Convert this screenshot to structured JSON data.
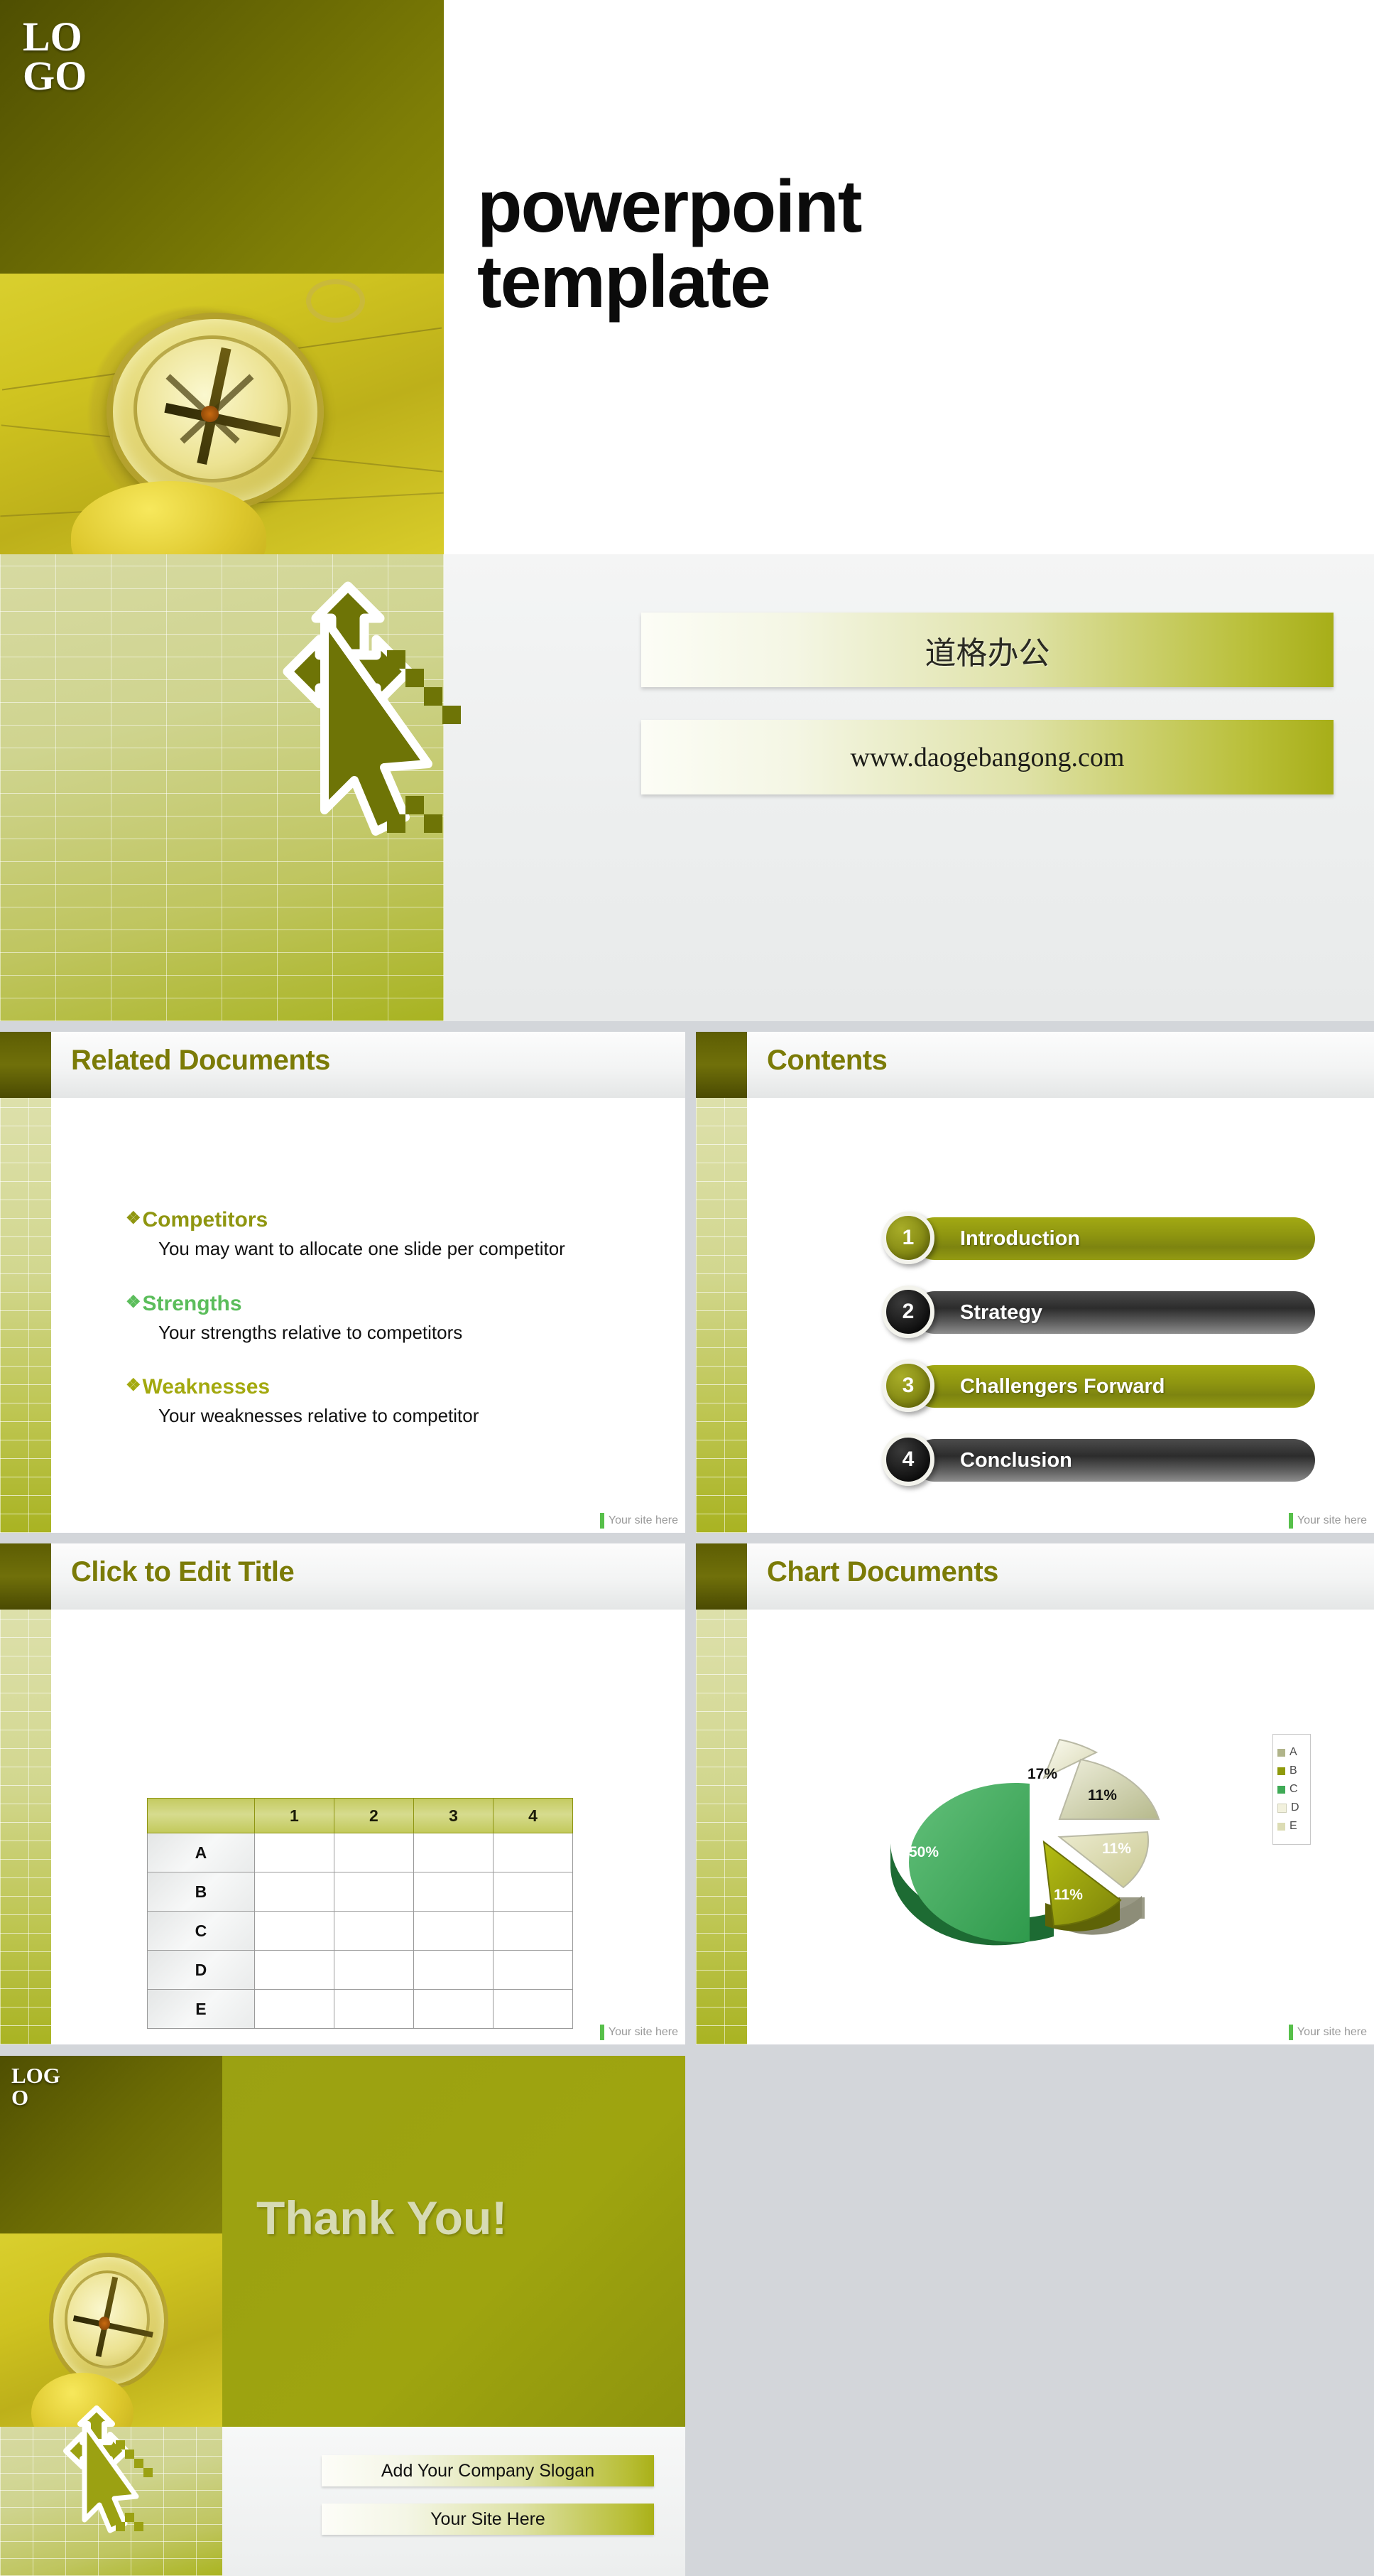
{
  "cover": {
    "logo_text": "LOGO",
    "title_line1": "powerpoint",
    "title_line2": "template",
    "box_cn": "道格办公",
    "box_url": "www.daogebangong.com"
  },
  "related": {
    "title": "Related Documents",
    "items": [
      {
        "bullet": "❖",
        "head": "Competitors",
        "sub": "You may want to allocate one slide per competitor",
        "color": "#8f9610"
      },
      {
        "bullet": "❖",
        "head": "Strengths",
        "sub": "Your strengths relative to competitors",
        "color": "#5bbd5b"
      },
      {
        "bullet": "❖",
        "head": "Weaknesses",
        "sub": "Your weaknesses relative to competitor",
        "color": "#a3a90f"
      }
    ],
    "footer": "Your site here"
  },
  "contents": {
    "title": "Contents",
    "items": [
      {
        "number": "1",
        "label": "Introduction",
        "style": "olive"
      },
      {
        "number": "2",
        "label": "Strategy",
        "style": "dark"
      },
      {
        "number": "3",
        "label": "Challengers Forward",
        "style": "olive"
      },
      {
        "number": "4",
        "label": "Conclusion",
        "style": "dark"
      }
    ],
    "footer": "Your site here"
  },
  "table_slide": {
    "title": "Click to Edit Title",
    "columns": [
      "",
      "1",
      "2",
      "3",
      "4"
    ],
    "rows": [
      {
        "label": "A",
        "cells": [
          "",
          "",
          "",
          ""
        ]
      },
      {
        "label": "B",
        "cells": [
          "",
          "",
          "",
          ""
        ]
      },
      {
        "label": "C",
        "cells": [
          "",
          "",
          "",
          ""
        ]
      },
      {
        "label": "D",
        "cells": [
          "",
          "",
          "",
          ""
        ]
      },
      {
        "label": "E",
        "cells": [
          "",
          "",
          "",
          ""
        ]
      }
    ],
    "footer": "Your site here"
  },
  "chart_slide": {
    "title": "Chart Documents",
    "footer": "Your site here"
  },
  "chart_data": {
    "type": "pie",
    "title": "Chart Documents",
    "categories": [
      "A",
      "B",
      "C",
      "D",
      "E"
    ],
    "values": [
      11,
      11,
      50,
      17,
      11
    ],
    "labels": [
      "11%",
      "11%",
      "50%",
      "17%",
      "11%"
    ],
    "colors": [
      "#b0b48a",
      "#8f9a0c",
      "#3faa56",
      "#f2f1dd",
      "#dcdcb4"
    ],
    "legend": [
      "A",
      "B",
      "C",
      "D",
      "E"
    ],
    "legend_position": "right",
    "exploded": true,
    "three_d": true
  },
  "thanks": {
    "logo_text": "LOGO",
    "heading": "Thank You!",
    "slogan_button": "Add Your Company Slogan",
    "site_button": "Your Site Here"
  }
}
